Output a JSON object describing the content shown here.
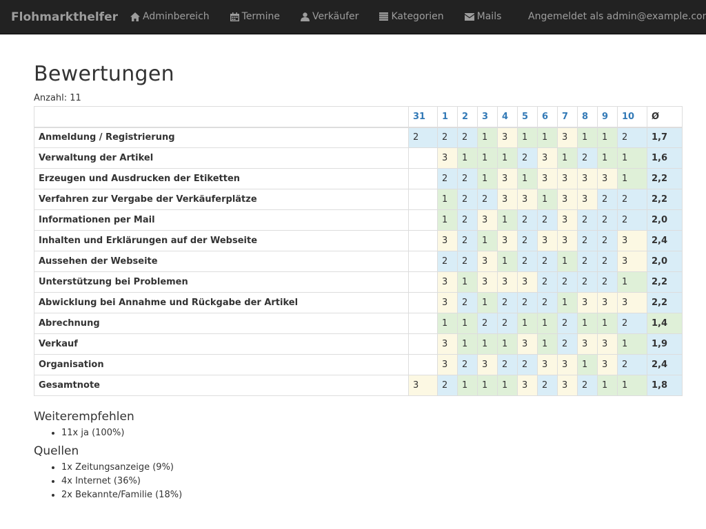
{
  "brand": "Flohmarkthelfer",
  "nav": [
    {
      "label": "Adminbereich",
      "icon": "home-icon"
    },
    {
      "label": "Termine",
      "icon": "calendar-icon"
    },
    {
      "label": "Verkäufer",
      "icon": "user-icon"
    },
    {
      "label": "Kategorien",
      "icon": "list-icon"
    },
    {
      "label": "Mails",
      "icon": "envelope-icon"
    }
  ],
  "logged_in": "Angemeldet als admin@example.com",
  "page_title": "Bewertungen",
  "count_label": "Anzahl: 11",
  "table": {
    "columns": [
      "31",
      "1",
      "2",
      "3",
      "4",
      "5",
      "6",
      "7",
      "8",
      "9",
      "10"
    ],
    "avg_header": "Ø",
    "rows": [
      {
        "label": "Anmeldung / Registrierung",
        "values": [
          "2",
          "2",
          "2",
          "1",
          "3",
          "1",
          "1",
          "3",
          "1",
          "1",
          "2"
        ],
        "avg": "1,7"
      },
      {
        "label": "Verwaltung der Artikel",
        "values": [
          "",
          "3",
          "1",
          "1",
          "1",
          "2",
          "3",
          "1",
          "2",
          "1",
          "1"
        ],
        "avg": "1,6"
      },
      {
        "label": "Erzeugen und Ausdrucken der Etiketten",
        "values": [
          "",
          "2",
          "2",
          "1",
          "3",
          "1",
          "3",
          "3",
          "3",
          "3",
          "1"
        ],
        "avg": "2,2"
      },
      {
        "label": "Verfahren zur Vergabe der Verkäuferplätze",
        "values": [
          "",
          "1",
          "2",
          "2",
          "3",
          "3",
          "1",
          "3",
          "3",
          "2",
          "2"
        ],
        "avg": "2,2"
      },
      {
        "label": "Informationen per Mail",
        "values": [
          "",
          "1",
          "2",
          "3",
          "1",
          "2",
          "2",
          "3",
          "2",
          "2",
          "2"
        ],
        "avg": "2,0"
      },
      {
        "label": "Inhalten und Erklärungen auf der Webseite",
        "values": [
          "",
          "3",
          "2",
          "1",
          "3",
          "2",
          "3",
          "3",
          "2",
          "2",
          "3"
        ],
        "avg": "2,4"
      },
      {
        "label": "Aussehen der Webseite",
        "values": [
          "",
          "2",
          "2",
          "3",
          "1",
          "2",
          "2",
          "1",
          "2",
          "2",
          "3"
        ],
        "avg": "2,0"
      },
      {
        "label": "Unterstützung bei Problemen",
        "values": [
          "",
          "3",
          "1",
          "3",
          "3",
          "3",
          "2",
          "2",
          "2",
          "2",
          "1"
        ],
        "avg": "2,2"
      },
      {
        "label": "Abwicklung bei Annahme und Rückgabe der Artikel",
        "values": [
          "",
          "3",
          "2",
          "1",
          "2",
          "2",
          "2",
          "1",
          "3",
          "3",
          "3"
        ],
        "avg": "2,2"
      },
      {
        "label": "Abrechnung",
        "values": [
          "",
          "1",
          "1",
          "2",
          "2",
          "1",
          "1",
          "2",
          "1",
          "1",
          "2"
        ],
        "avg": "1,4"
      },
      {
        "label": "Verkauf",
        "values": [
          "",
          "3",
          "1",
          "1",
          "1",
          "3",
          "1",
          "2",
          "3",
          "3",
          "1"
        ],
        "avg": "1,9"
      },
      {
        "label": "Organisation",
        "values": [
          "",
          "3",
          "2",
          "3",
          "2",
          "2",
          "3",
          "3",
          "1",
          "3",
          "2"
        ],
        "avg": "2,4"
      },
      {
        "label": "Gesamtnote",
        "values": [
          "3",
          "2",
          "1",
          "1",
          "1",
          "3",
          "2",
          "3",
          "2",
          "1",
          "1"
        ],
        "avg": "1,8"
      }
    ]
  },
  "recommend": {
    "title": "Weiterempfehlen",
    "items": [
      "11x ja (100%)"
    ]
  },
  "sources": {
    "title": "Quellen",
    "items": [
      "1x Zeitungsanzeige (9%)",
      "4x Internet (36%)",
      "2x Bekannte/Familie (18%)"
    ]
  },
  "colors": {
    "rating_1": "#dff0d8",
    "rating_2": "#d9edf7",
    "rating_3": "#fcf8e3",
    "navbar": "#222222",
    "link": "#337ab7"
  }
}
